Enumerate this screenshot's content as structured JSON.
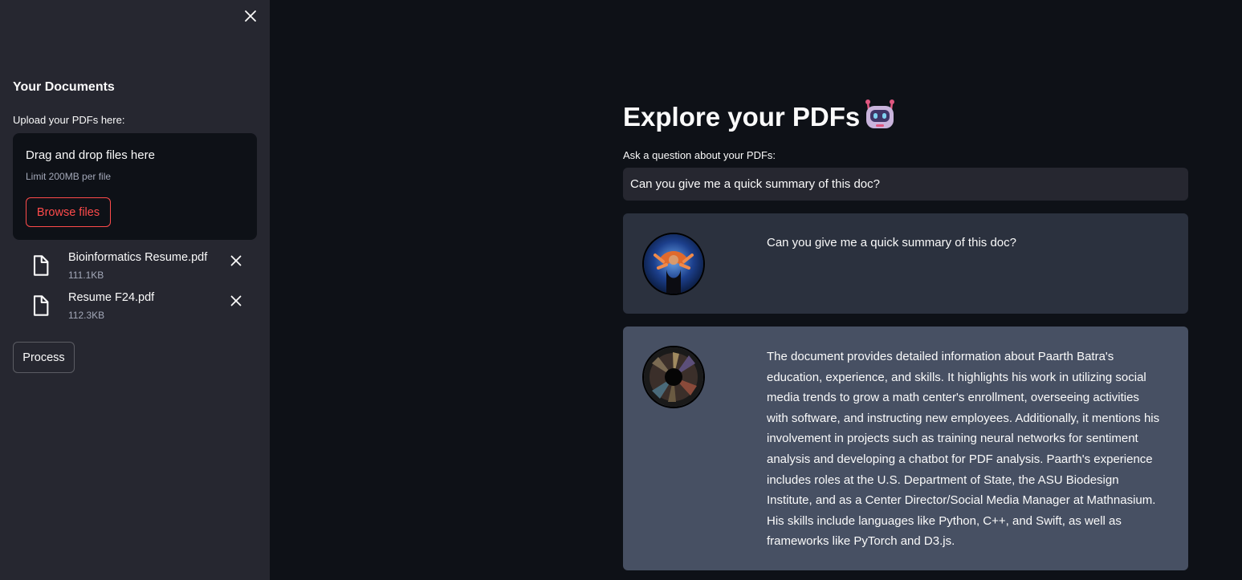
{
  "sidebar": {
    "title": "Your Documents",
    "upload_label": "Upload your PDFs here:",
    "dropzone": {
      "title": "Drag and drop files here",
      "limit": "Limit 200MB per file",
      "browse_label": "Browse files"
    },
    "files": [
      {
        "name": "Bioinformatics Resume.pdf",
        "size": "111.1KB"
      },
      {
        "name": "Resume F24.pdf",
        "size": "112.3KB"
      }
    ],
    "process_label": "Process"
  },
  "main": {
    "title": "Explore your PDFs",
    "question_label": "Ask a question about your PDFs:",
    "question_value": "Can you give me a quick summary of this doc?",
    "messages": [
      {
        "role": "user",
        "text": "Can you give me a quick summary of this doc?"
      },
      {
        "role": "bot",
        "text": "The document provides detailed information about Paarth Batra's education, experience, and skills. It highlights his work in utilizing social media trends to grow a math center's enrollment, overseeing activities with software, and instructing new employees. Additionally, it mentions his involvement in projects such as training neural networks for sentiment analysis and developing a chatbot for PDF analysis. Paarth's experience includes roles at the U.S. Department of State, the ASU Biodesign Institute, and as a Center Director/Social Media Manager at Mathnasium. His skills include languages like Python, C++, and Swift, as well as frameworks like PyTorch and D3.js."
      }
    ]
  },
  "colors": {
    "background": "#0e1117",
    "sidebar": "#262730",
    "accent": "#ff4b4b",
    "user_message": "#2b313e",
    "bot_message": "#475063"
  },
  "icons": [
    "close-icon",
    "file-icon",
    "robot-icon",
    "user-avatar",
    "bot-avatar"
  ]
}
